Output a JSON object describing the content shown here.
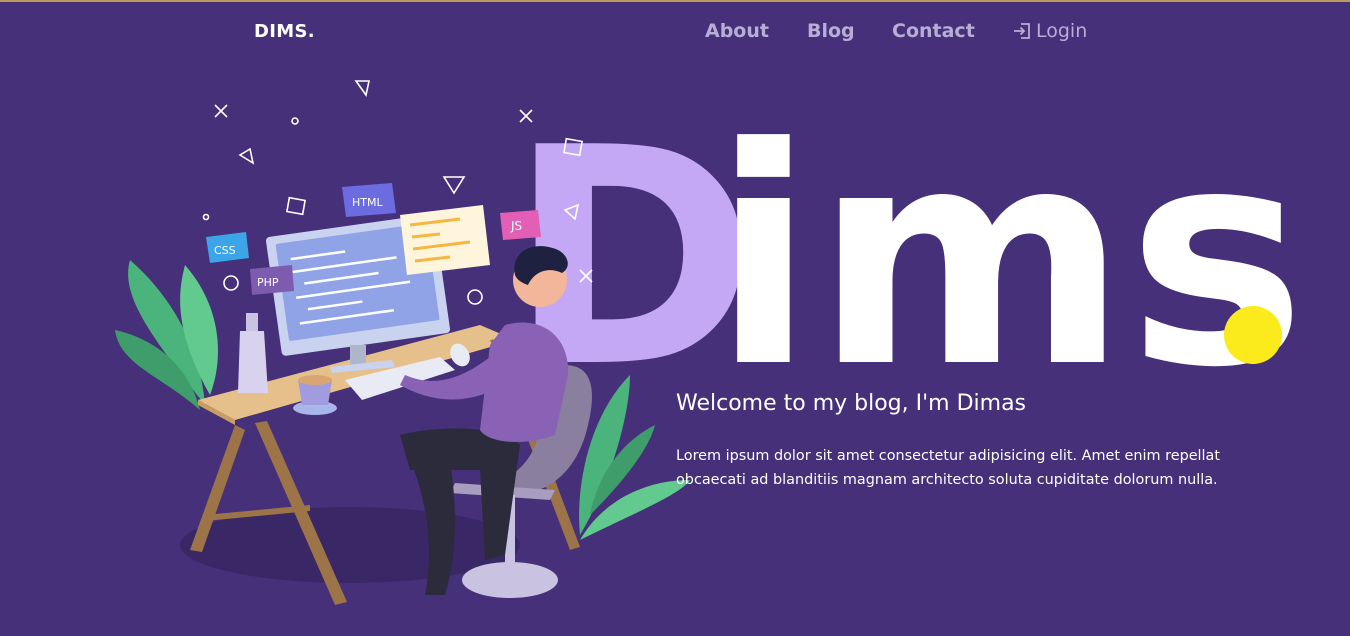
{
  "header": {
    "brand": "DIMS.",
    "nav": {
      "about": "About",
      "blog": "Blog",
      "contact": "Contact",
      "login": "Login",
      "login_icon": "login-icon"
    }
  },
  "hero": {
    "big_title_main": "Dims",
    "big_title_dot": ".",
    "welcome": "Welcome to my blog, I'm Dimas",
    "description": "Lorem ipsum dolor sit amet consectetur adipisicing elit. Amet enim repellat obcaecati ad blanditiis magnam architecto soluta cupiditate dolorum nulla."
  },
  "illustration": {
    "tags": [
      "HTML",
      "CSS",
      "PHP",
      "JS"
    ],
    "icon": "developer-at-desk-illustration"
  },
  "colors": {
    "background": "#46307a",
    "accent_purple": "#c4a8f5",
    "dot_yellow": "#fbea1c",
    "nav_text": "#b9add6"
  }
}
